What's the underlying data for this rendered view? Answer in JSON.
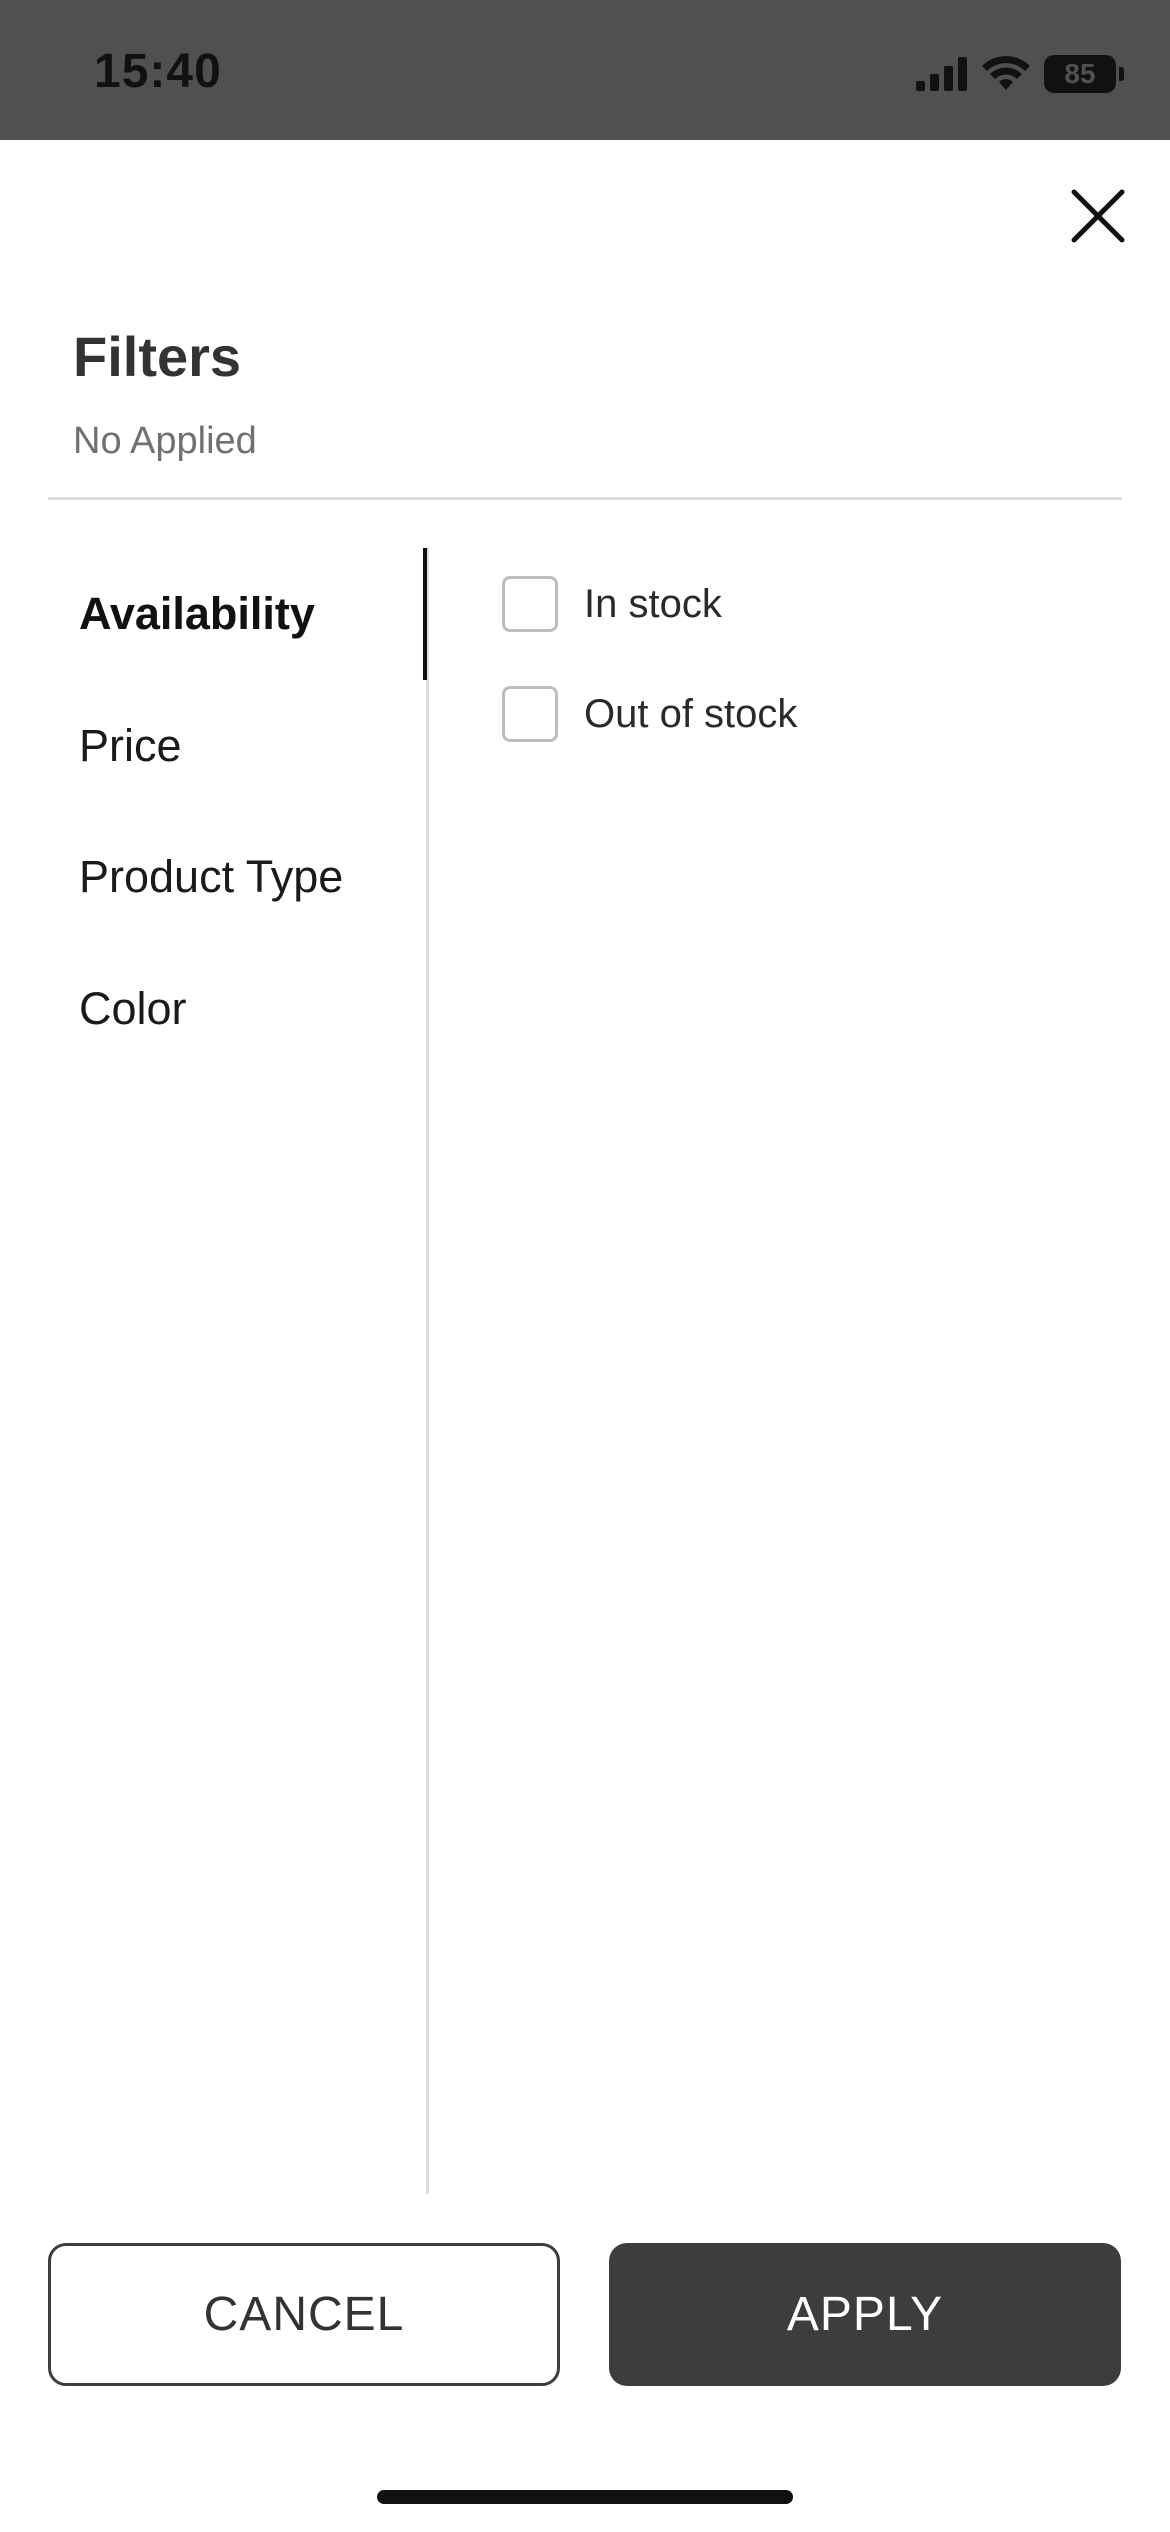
{
  "status_bar": {
    "time": "15:40",
    "battery": "85",
    "icons": [
      "signal-icon",
      "wifi-icon",
      "battery-icon"
    ]
  },
  "header": {
    "close_icon": "close-icon",
    "title": "Filters",
    "subtitle": "No Applied"
  },
  "categories": [
    {
      "label": "Availability",
      "active": true
    },
    {
      "label": "Price",
      "active": false
    },
    {
      "label": "Product Type",
      "active": false
    },
    {
      "label": "Color",
      "active": false
    }
  ],
  "options": [
    {
      "label": "In stock",
      "checked": false
    },
    {
      "label": "Out of stock",
      "checked": false
    }
  ],
  "buttons": {
    "cancel": "CANCEL",
    "apply": "APPLY"
  },
  "colors": {
    "status_bar_bg": "#505050",
    "primary_button": "#3d3d3d",
    "divider": "#dcdcdc"
  }
}
